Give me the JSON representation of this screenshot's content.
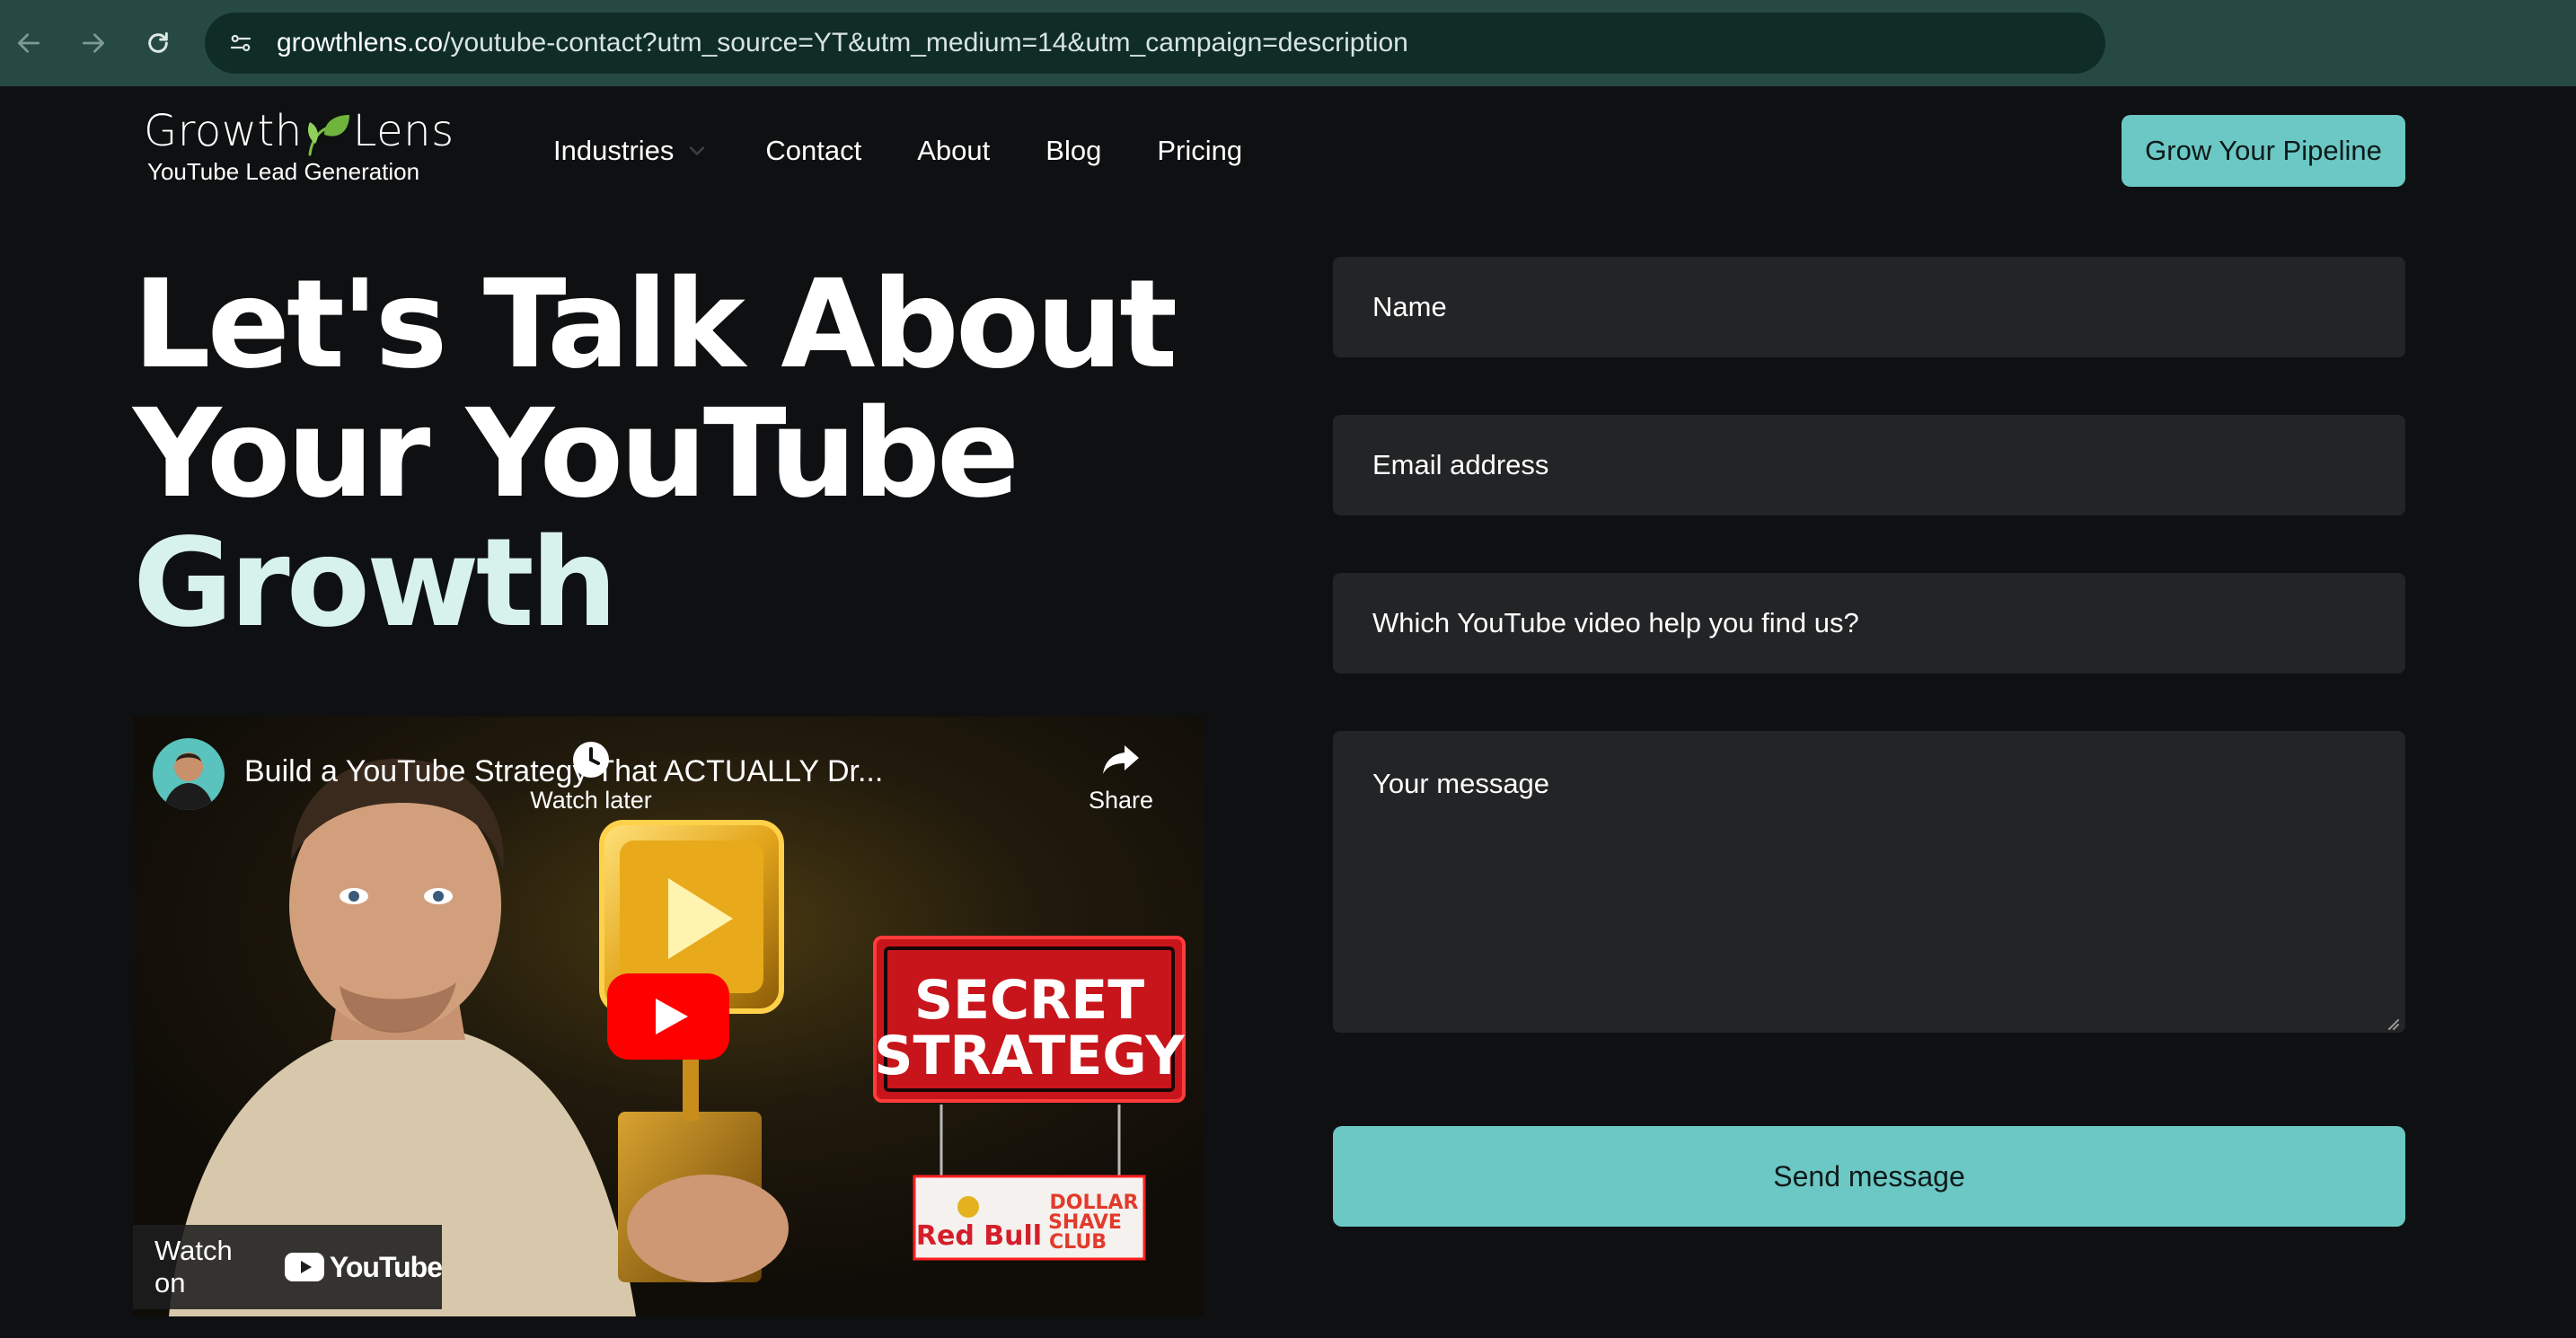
{
  "browser": {
    "url_host": "growthlens.co",
    "url_path": "/youtube-contact?utm_source=YT&utm_medium=14&utm_campaign=description"
  },
  "logo": {
    "word_left": "Growth",
    "word_right": "Lens",
    "tagline": "YouTube Lead Generation"
  },
  "nav": {
    "items": [
      "Industries",
      "Contact",
      "About",
      "Blog",
      "Pricing"
    ],
    "cta": "Grow Your Pipeline"
  },
  "hero": {
    "line1": "Let's Talk About",
    "line2": "Your YouTube",
    "accent": "Growth"
  },
  "video": {
    "title": "Build a YouTube Strategy That ACTUALLY Dr...",
    "watch_later": "Watch later",
    "share": "Share",
    "watch_on": "Watch on",
    "youtube_word": "YouTube",
    "thumb_sign_line1": "SECRET",
    "thumb_sign_line2": "STRATEGY",
    "thumb_brand1": "Red Bull",
    "thumb_brand2_line1": "DOLLAR",
    "thumb_brand2_line2": "SHAVE",
    "thumb_brand2_line3": "CLUB"
  },
  "form": {
    "name_placeholder": "Name",
    "email_placeholder": "Email address",
    "video_placeholder": "Which YouTube video help you find us?",
    "message_placeholder": "Your message",
    "submit": "Send message"
  },
  "colors": {
    "accent": "#6cc8c4",
    "browser_bar": "#264a43",
    "page_bg": "#0f1011",
    "field_bg": "#232425"
  }
}
